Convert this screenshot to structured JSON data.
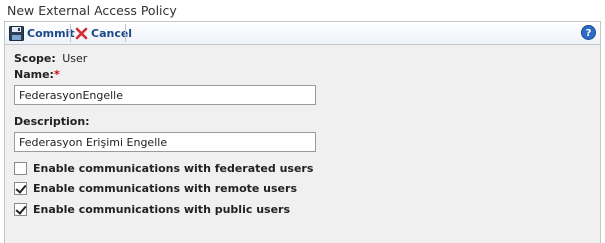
{
  "page": {
    "title": "New External Access Policy"
  },
  "toolbar": {
    "commit_label": "Commit",
    "cancel_label": "Cancel",
    "help_glyph": "?"
  },
  "form": {
    "scope_label": "Scope:",
    "scope_value": "User",
    "name_label": "Name:",
    "required_marker": "*",
    "name_value": "FederasyonEngelle",
    "description_label": "Description:",
    "description_value": "Federasyon Erişimi Engelle"
  },
  "options": [
    {
      "label": "Enable communications with federated users",
      "checked": false
    },
    {
      "label": "Enable communications with remote users",
      "checked": true
    },
    {
      "label": "Enable communications with public users",
      "checked": true
    }
  ],
  "icons": {
    "commit": "save-icon",
    "cancel": "cancel-x-icon",
    "help": "help-icon"
  },
  "colors": {
    "accent": "#1a4a8a",
    "cancel_x": "#d42b2b",
    "required": "#dd0000"
  }
}
